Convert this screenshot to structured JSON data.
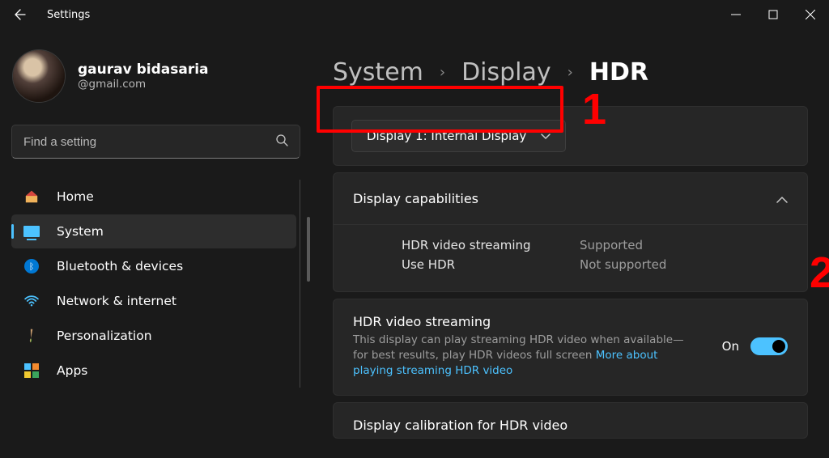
{
  "window": {
    "title": "Settings"
  },
  "profile": {
    "name": "gaurav bidasaria",
    "email": "@gmail.com"
  },
  "search": {
    "placeholder": "Find a setting"
  },
  "nav": {
    "items": [
      {
        "label": "Home"
      },
      {
        "label": "System"
      },
      {
        "label": "Bluetooth & devices"
      },
      {
        "label": "Network & internet"
      },
      {
        "label": "Personalization"
      },
      {
        "label": "Apps"
      }
    ]
  },
  "breadcrumb": {
    "crumb1": "System",
    "crumb2": "Display",
    "current": "HDR"
  },
  "display_selector": {
    "label": "Display 1: Internal Display"
  },
  "capabilities": {
    "header": "Display capabilities",
    "rows": [
      {
        "label": "HDR video streaming",
        "value": "Supported"
      },
      {
        "label": "Use HDR",
        "value": "Not supported"
      }
    ]
  },
  "hdr_stream": {
    "title": "HDR video streaming",
    "desc_pre": "This display can play streaming HDR video when available—for best results, play HDR videos full screen  ",
    "link": "More about playing streaming HDR video",
    "state_label": "On"
  },
  "calibration": {
    "title": "Display calibration for HDR video"
  },
  "annotations": {
    "one": "1",
    "two": "2"
  }
}
